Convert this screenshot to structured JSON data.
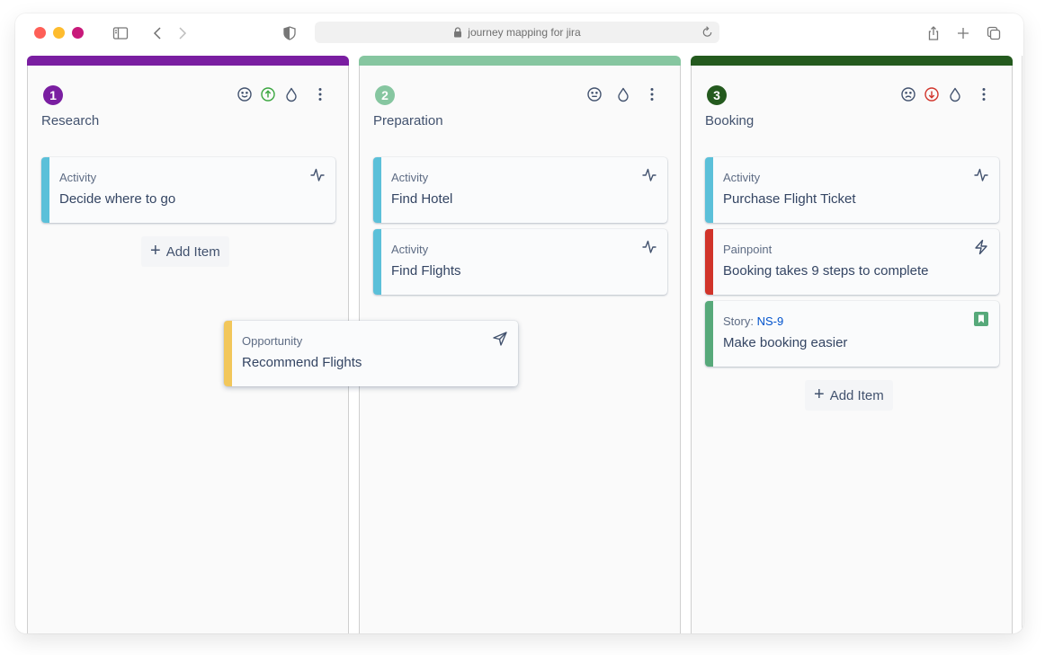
{
  "browser": {
    "url_text": "journey mapping for jira",
    "icons": {
      "sidebar": "sidebar-icon",
      "back": "chevron-left-icon",
      "forward": "chevron-right-icon",
      "privacy": "shield-icon",
      "lock": "lock-icon",
      "reload": "reload-icon",
      "share": "share-icon",
      "new_tab": "plus-icon",
      "tabs": "tabs-overview-icon"
    }
  },
  "colors": {
    "stage_1": "#7a1ea1",
    "stage_2": "#86c6a0",
    "stage_3": "#245a1e",
    "activity": "#5bc0d9",
    "opportunity": "#f2c75b",
    "painpoint": "#d1342a",
    "story": "#57a97a",
    "trend_up": "#3aa63f",
    "trend_down": "#d1342a"
  },
  "columns": [
    {
      "number": "1",
      "title": "Research",
      "emotion": "happy",
      "trend": "up",
      "cards": [
        {
          "type": "Activity",
          "title": "Decide where to go",
          "icon": "activity-icon"
        }
      ],
      "add_item_label": "Add Item"
    },
    {
      "number": "2",
      "title": "Preparation",
      "emotion": "neutral",
      "cards": [
        {
          "type": "Activity",
          "title": "Find Hotel",
          "icon": "activity-icon"
        },
        {
          "type": "Activity",
          "title": "Find Flights",
          "icon": "activity-icon"
        }
      ]
    },
    {
      "number": "3",
      "title": "Booking",
      "emotion": "sad",
      "trend": "down",
      "cards": [
        {
          "type": "Activity",
          "title": "Purchase Flight Ticket",
          "icon": "activity-icon"
        },
        {
          "type": "Painpoint",
          "title": "Booking takes 9 steps to complete",
          "icon": "lightning-icon"
        },
        {
          "type": "Story:",
          "issue_key": "NS-9",
          "title": "Make booking easier",
          "icon": "jira-story-icon"
        }
      ],
      "add_item_label": "Add Item"
    }
  ],
  "dragging_card": {
    "type": "Opportunity",
    "title": "Recommend Flights",
    "icon": "send-icon"
  }
}
